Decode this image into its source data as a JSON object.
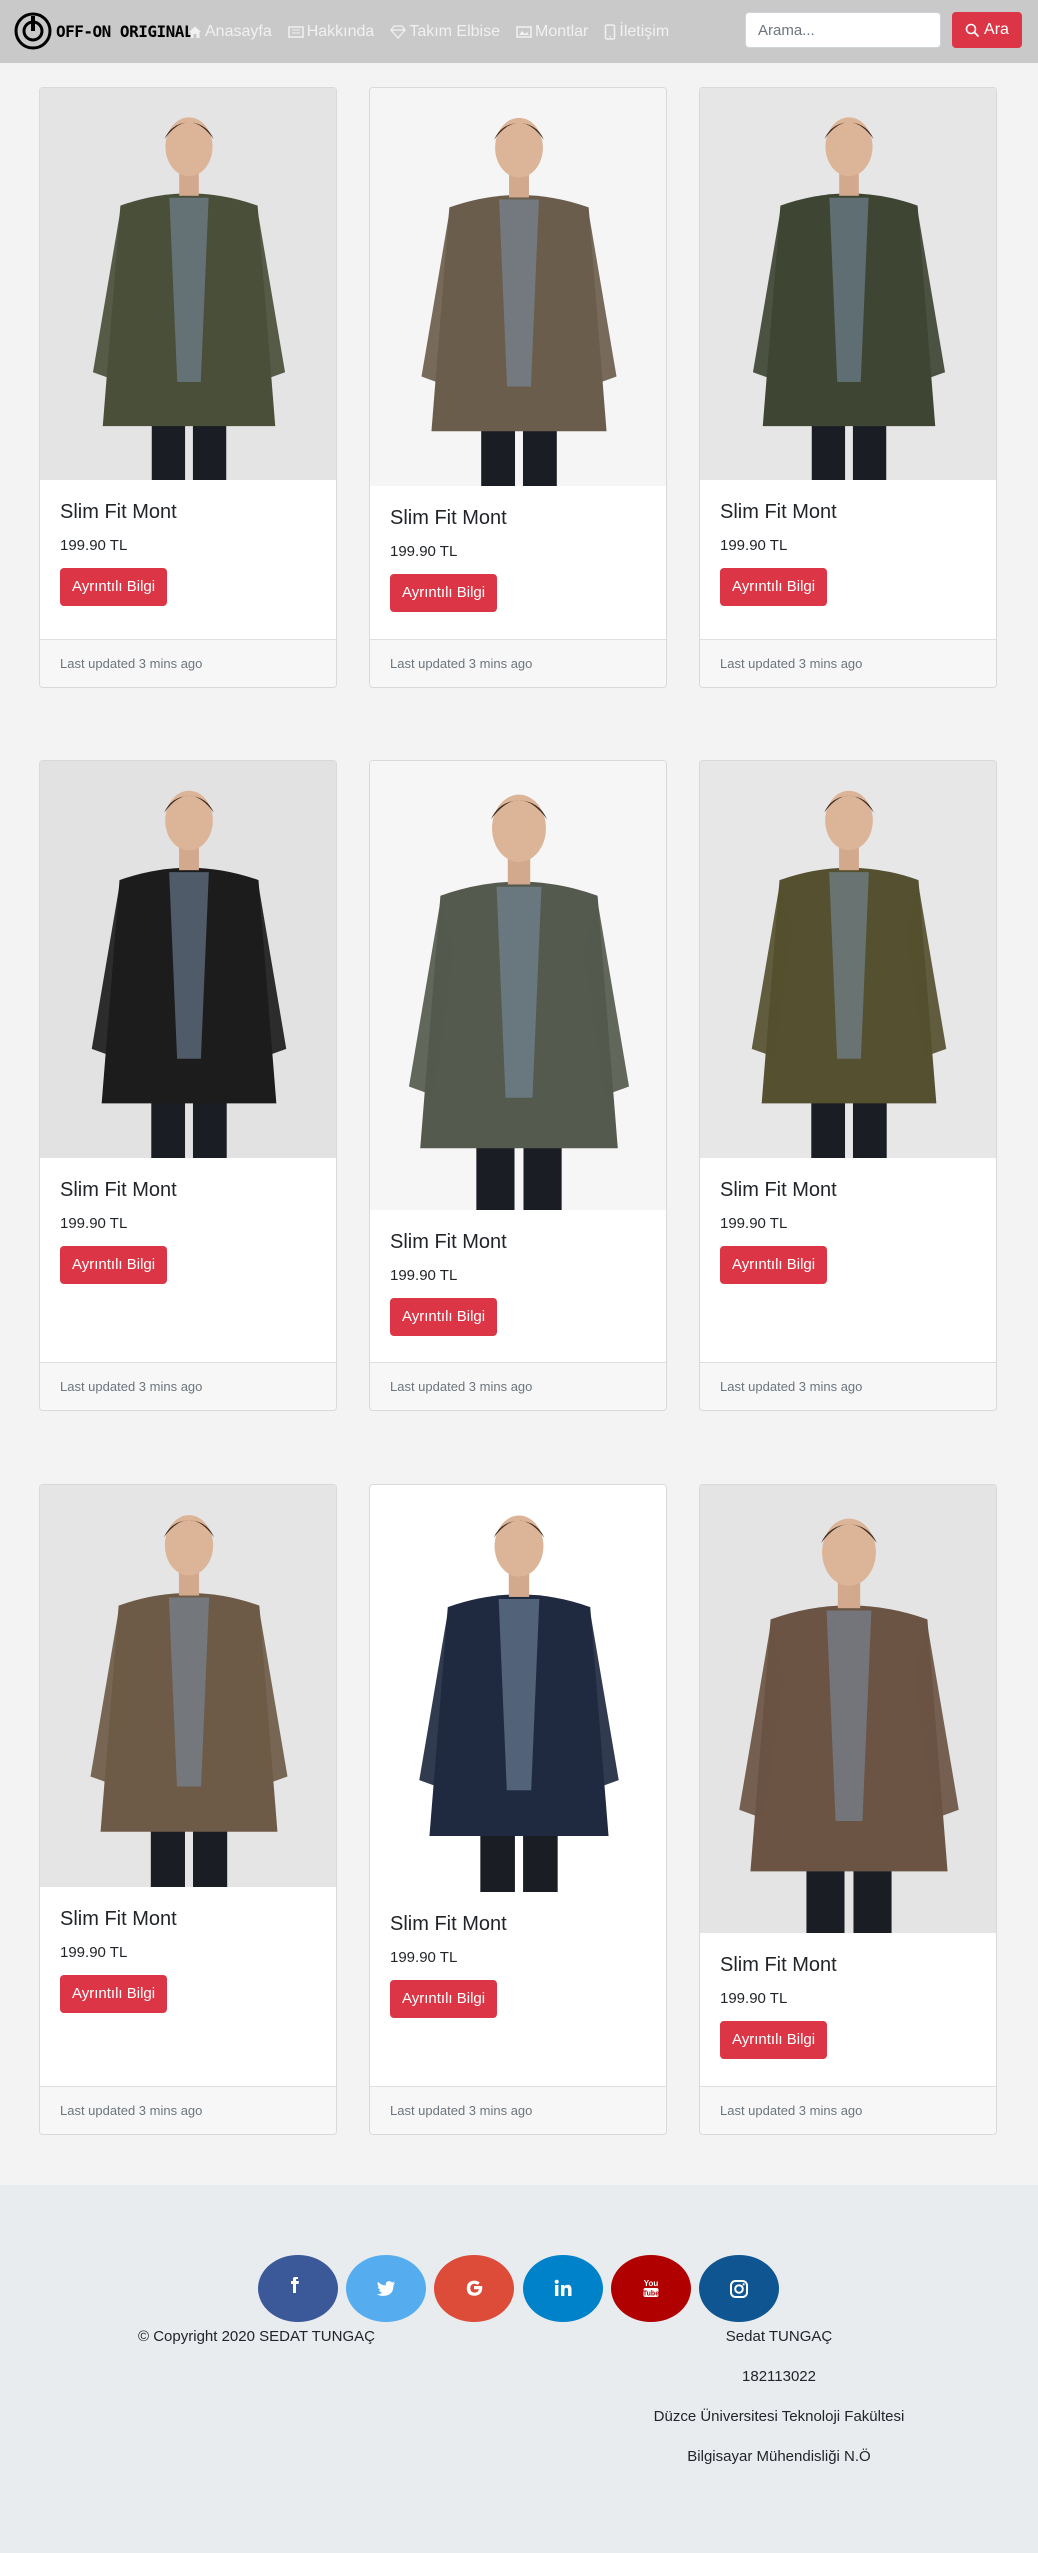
{
  "navbar": {
    "brand": "OFF-ON ORIGINAL",
    "links": [
      {
        "label": "Anasayfa",
        "icon": "home-icon"
      },
      {
        "label": "Hakkında",
        "icon": "newspaper-icon"
      },
      {
        "label": "Takım Elbise",
        "icon": "gem-icon"
      },
      {
        "label": "Montlar",
        "icon": "image-icon"
      },
      {
        "label": "İletişim",
        "icon": "phone-icon"
      }
    ],
    "search_placeholder": "Arama...",
    "search_button": "Ara"
  },
  "products": [
    {
      "title": "Slim Fit Mont",
      "price": "199.90 TL",
      "button": "Ayrıntılı Bilgi",
      "updated": "Last updated 3 mins ago",
      "coat_color": "#4a4f3a",
      "bg": "#e4e4e4"
    },
    {
      "title": "Slim Fit Mont",
      "price": "199.90 TL",
      "button": "Ayrıntılı Bilgi",
      "updated": "Last updated 3 mins ago",
      "coat_color": "#6b5d4c",
      "bg": "#f5f5f5"
    },
    {
      "title": "Slim Fit Mont",
      "price": "199.90 TL",
      "button": "Ayrıntılı Bilgi",
      "updated": "Last updated 3 mins ago",
      "coat_color": "#3f4533",
      "bg": "#e6e6e6"
    },
    {
      "title": "Slim Fit Mont",
      "price": "199.90 TL",
      "button": "Ayrıntılı Bilgi",
      "updated": "Last updated 3 mins ago",
      "coat_color": "#1c1c1c",
      "bg": "#e2e2e2"
    },
    {
      "title": "Slim Fit Mont",
      "price": "199.90 TL",
      "button": "Ayrıntılı Bilgi",
      "updated": "Last updated 3 mins ago",
      "coat_color": "#545a4d",
      "bg": "#f6f6f6"
    },
    {
      "title": "Slim Fit Mont",
      "price": "199.90 TL",
      "button": "Ayrıntılı Bilgi",
      "updated": "Last updated 3 mins ago",
      "coat_color": "#55502f",
      "bg": "#e7e7e7"
    },
    {
      "title": "Slim Fit Mont",
      "price": "199.90 TL",
      "button": "Ayrıntılı Bilgi",
      "updated": "Last updated 3 mins ago",
      "coat_color": "#6e5b47",
      "bg": "#e5e5e5"
    },
    {
      "title": "Slim Fit Mont",
      "price": "199.90 TL",
      "button": "Ayrıntılı Bilgi",
      "updated": "Last updated 3 mins ago",
      "coat_color": "#1f2a40",
      "bg": "#ffffff"
    },
    {
      "title": "Slim Fit Mont",
      "price": "199.90 TL",
      "button": "Ayrıntılı Bilgi",
      "updated": "Last updated 3 mins ago",
      "coat_color": "#6b5443",
      "bg": "#e4e4e4"
    }
  ],
  "footer": {
    "social": [
      {
        "name": "facebook-icon",
        "color": "#3b5998"
      },
      {
        "name": "twitter-icon",
        "color": "#55acee"
      },
      {
        "name": "google-icon",
        "color": "#dd4b39"
      },
      {
        "name": "linkedin-icon",
        "color": "#0082ca"
      },
      {
        "name": "youtube-icon",
        "color": "#b00000"
      },
      {
        "name": "instagram-icon",
        "color": "#0e5591"
      }
    ],
    "copyright": "© Copyright 2020 SEDAT TUNGAÇ",
    "info": [
      "Sedat TUNGAÇ",
      "182113022",
      "Düzce Üniversitesi Teknoloji Fakültesi",
      "Bilgisayar Mühendisliği N.Ö"
    ]
  }
}
